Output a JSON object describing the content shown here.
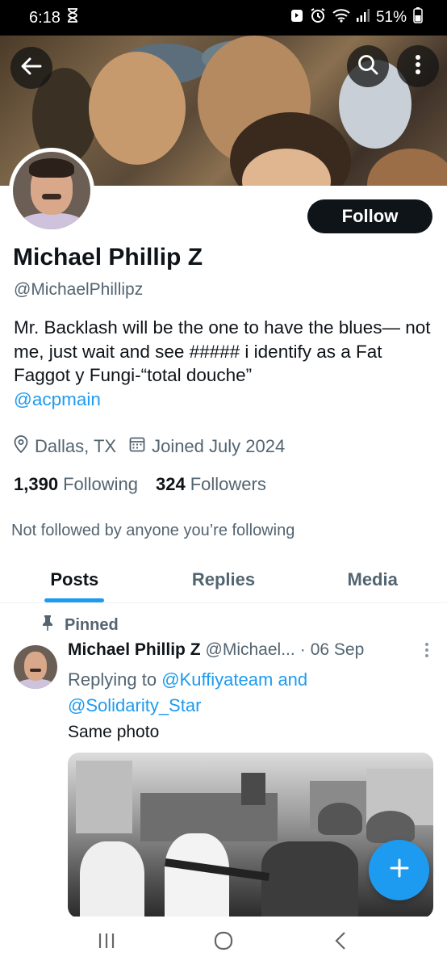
{
  "status": {
    "time": "6:18",
    "battery": "51%",
    "icons": [
      "hourglass-icon",
      "app-icon",
      "alarm-icon",
      "wifi-icon",
      "signal-icon",
      "battery-icon"
    ]
  },
  "header": {
    "back_icon": "arrow-left-icon",
    "search_icon": "search-icon",
    "more_icon": "more-vertical-icon"
  },
  "profile": {
    "name": "Michael Phillip Z",
    "handle": "@MichaelPhillipz",
    "follow_label": "Follow",
    "bio": "Mr. Backlash will be the one to have the blues— not me, just wait and see ##### i identify as a Fat Faggot y Fungi-“total douche”",
    "bio_mention": "@acpmain",
    "location": "Dallas, TX",
    "joined": "Joined July 2024",
    "following_count": "1,390",
    "following_label": "Following",
    "followers_count": "324",
    "followers_label": "Followers",
    "not_followed": "Not followed by anyone you’re following"
  },
  "tabs": [
    {
      "label": "Posts",
      "active": true
    },
    {
      "label": "Replies",
      "active": false
    },
    {
      "label": "Media",
      "active": false
    }
  ],
  "post": {
    "pinned_label": "Pinned",
    "author_name": "Michael Phillip Z",
    "author_handle": "@Michael...",
    "separator": "·",
    "date": "06 Sep",
    "replying_prefix": "Replying to",
    "replying_user1": "@Kuffiyateam",
    "replying_and": "and",
    "replying_user2": "@Solidarity_Star",
    "text": "Same photo"
  },
  "colors": {
    "accent": "#1d9bf0",
    "text_primary": "#0f1419",
    "text_secondary": "#536471",
    "follow_bg": "#0f1419"
  }
}
